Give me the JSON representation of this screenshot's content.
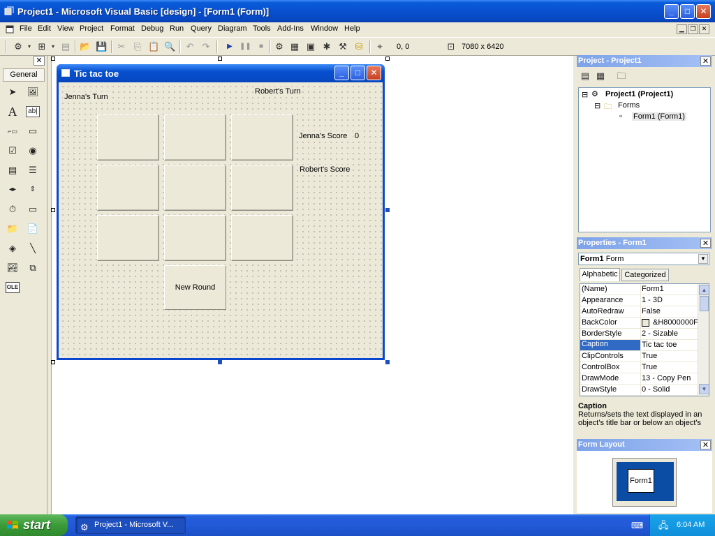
{
  "window": {
    "title": "Project1 - Microsoft Visual Basic [design] - [Form1 (Form)]",
    "min_label": "_",
    "max_label": "□",
    "close_label": "✕"
  },
  "menu": [
    "File",
    "Edit",
    "View",
    "Project",
    "Format",
    "Debug",
    "Run",
    "Query",
    "Diagram",
    "Tools",
    "Add-Ins",
    "Window",
    "Help"
  ],
  "toolbar": {
    "position": "0, 0",
    "size": "7080 x 6420"
  },
  "toolbox": {
    "tab_label": "General",
    "close_label": "✕"
  },
  "form": {
    "title": "Tic tac toe",
    "labels": {
      "jenna_turn": "Jenna's Turn",
      "robert_turn": "Robert's Turn",
      "jenna_score": "Jenna's Score",
      "jenna_score_value": "0",
      "robert_score": "Robert's Score"
    },
    "new_round": "New Round"
  },
  "project_panel": {
    "title": "Project - Project1",
    "tree": {
      "root": "Project1 (Project1)",
      "folder": "Forms",
      "form": "Form1 (Form1)"
    }
  },
  "properties_panel": {
    "title": "Properties - Form1",
    "object_name": "Form1",
    "object_type": "Form",
    "tabs": [
      "Alphabetic",
      "Categorized"
    ],
    "rows": [
      {
        "name": "(Name)",
        "value": "Form1"
      },
      {
        "name": "Appearance",
        "value": "1 - 3D"
      },
      {
        "name": "AutoRedraw",
        "value": "False"
      },
      {
        "name": "BackColor",
        "value": "&H8000000F"
      },
      {
        "name": "BorderStyle",
        "value": "2 - Sizable"
      },
      {
        "name": "Caption",
        "value": "Tic tac toe"
      },
      {
        "name": "ClipControls",
        "value": "True"
      },
      {
        "name": "ControlBox",
        "value": "True"
      },
      {
        "name": "DrawMode",
        "value": "13 - Copy Pen"
      },
      {
        "name": "DrawStyle",
        "value": "0 - Solid"
      }
    ],
    "selected_row": "Caption",
    "description_title": "Caption",
    "description_text": "Returns/sets the text displayed in an object's title bar or below an object's"
  },
  "form_layout_panel": {
    "title": "Form Layout",
    "form_label": "Form1"
  },
  "taskbar": {
    "start_label": "start",
    "task_label": "Project1 - Microsoft V...",
    "clock": "6:04 AM"
  }
}
